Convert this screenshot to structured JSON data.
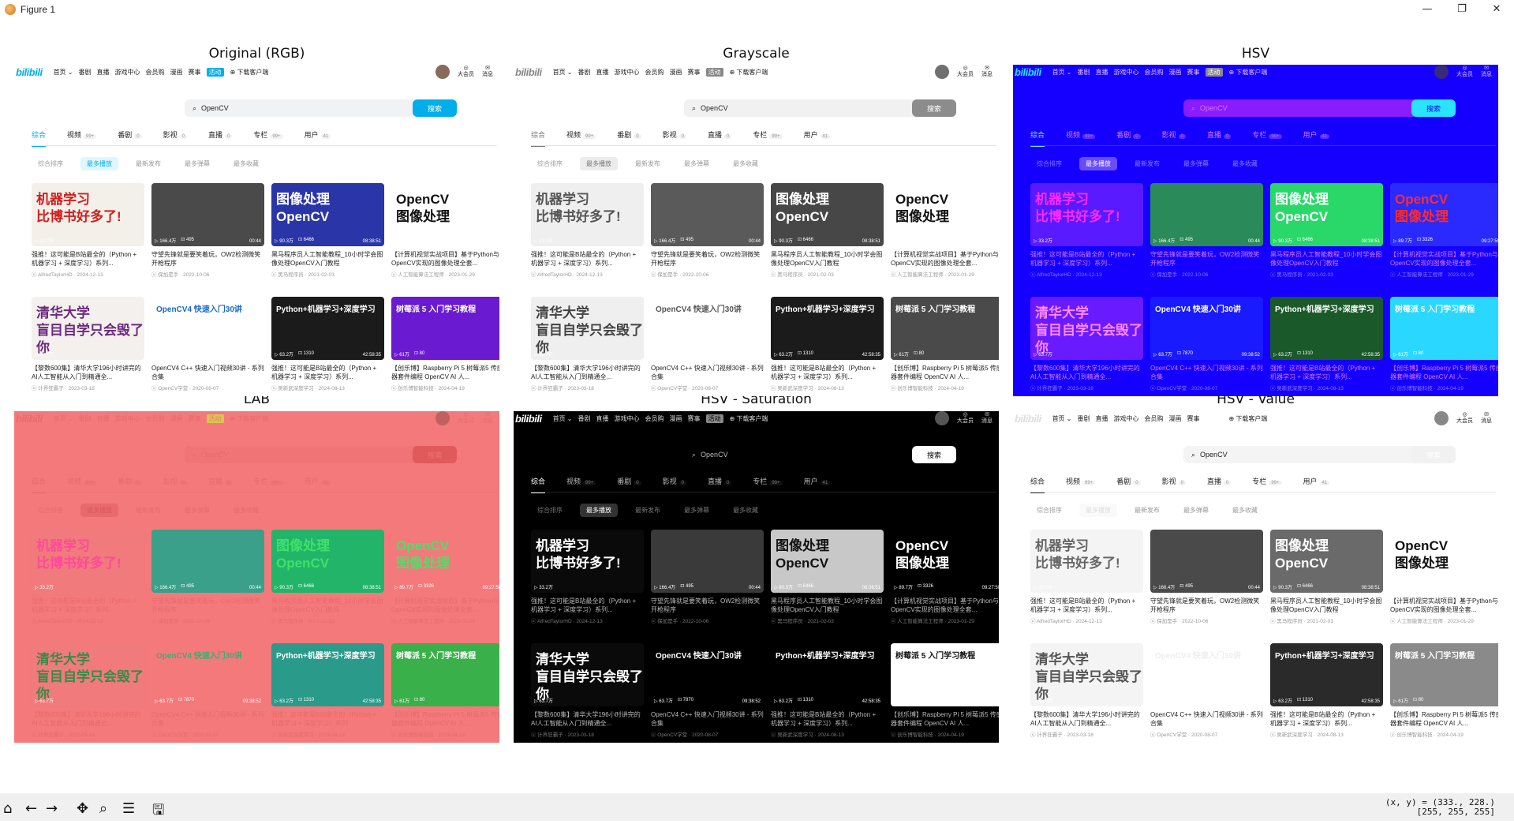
{
  "window": {
    "title": "Figure 1",
    "min": "—",
    "max": "❐",
    "close": "✕"
  },
  "panel_titles": [
    "Original (RGB)",
    "Grayscale",
    "HSV",
    "LAB",
    "HSV - Saturation",
    "HSV - Value"
  ],
  "site": {
    "logo": "bilibili",
    "nav_items": [
      "首页 ⌄",
      "番剧",
      "直播",
      "游戏中心",
      "会员购",
      "漫画",
      "赛事"
    ],
    "nav_badge": "活动",
    "download": "⊕ 下载客户端",
    "nav_right": [
      "大会员",
      "消息"
    ],
    "search_value": "OpenCV",
    "search_button": "搜索",
    "tabs": [
      {
        "label": "综合",
        "count": ""
      },
      {
        "label": "视频",
        "count": "99+"
      },
      {
        "label": "番剧",
        "count": "0"
      },
      {
        "label": "影视",
        "count": "0"
      },
      {
        "label": "直播",
        "count": "0"
      },
      {
        "label": "专栏",
        "count": "99+"
      },
      {
        "label": "用户",
        "count": "41"
      }
    ],
    "sorts": [
      "综合排序",
      "最多播放",
      "最新发布",
      "最多弹幕",
      "最多收藏"
    ],
    "cards": [
      {
        "thumb": "机器学习\n比博书好多了!",
        "plays": "▷ 33.2万",
        "likes": "",
        "duration": "",
        "title": "强推！这可能是B站最全的（Python + 机器学习 + 深度学习）系列...",
        "by": "ⓤ AlfredTaylorHD · 2024-12-13"
      },
      {
        "thumb": "",
        "plays": "▷ 166.4万",
        "likes": "⊡ 495",
        "duration": "00:44",
        "title": "守望先锋就是要笑着玩，OW2检测微笑开枪程序",
        "by": "ⓤ 保加是手 · 2022-10-06"
      },
      {
        "thumb": "图像处理\nOpenCV",
        "plays": "▷ 90.3万",
        "likes": "⊡ 6466",
        "duration": "08:38:51",
        "title": "黑马程序员人工智能教程_10小时学会图像处理OpenCV入门教程",
        "by": "ⓤ 黑马程序员 · 2021-02-03"
      },
      {
        "thumb": "OpenCV\n图像处理",
        "plays": "▷ 89.7万",
        "likes": "⊡ 3326",
        "duration": "09:27:50",
        "title": "【计算机视觉实战项目】基于Python与OpenCV实现的图像处理全套...",
        "by": "ⓤ 人工智能算法工程师 · 2023-01-29"
      },
      {
        "thumb": "清华大学\n盲目自学只会毁了你",
        "plays": "▷ 63.7万",
        "likes": "",
        "duration": "",
        "title": "【黎数600集】清华大学196小时讲完的AI人工智能从入门到精通全...",
        "by": "ⓤ 计界狂霸子 · 2023-03-18"
      },
      {
        "thumb": "OpenCV4 快速入门30讲",
        "plays": "▷ 63.7万",
        "likes": "⊡ 7870",
        "duration": "09:38:52",
        "title": "OpenCV4 C++ 快速入门视频30讲 - 系列合集",
        "by": "ⓤ OpenCV学堂 · 2020-08-07"
      },
      {
        "thumb": "Python+机器学习+深度学习",
        "plays": "▷ 63.2万",
        "likes": "⊡ 1310",
        "duration": "42:58:35",
        "title": "强推！这可能是B站最全的（Python + 机器学习 + 深度学习）系列...",
        "by": "ⓤ 吴新武深度学习 · 2024-08-13"
      },
      {
        "thumb": "树莓派 5 入门学习教程",
        "plays": "▷ 61万",
        "likes": "⊡ 80",
        "duration": "",
        "title": "【创乐博】Raspberry Pi 5 树莓派5 传感器套件编程 OpenCV AI 人...",
        "by": "ⓤ 创乐博智能科技 · 2024-04-19"
      }
    ]
  },
  "toolbar": {
    "icons": [
      "home-icon",
      "back-arrow-icon",
      "forward-arrow-icon",
      "pan-icon",
      "zoom-icon",
      "configure-icon",
      "save-icon"
    ]
  },
  "coords": {
    "line1": "(x, y) = (333., 228.)",
    "line2": "[255, 255, 255]"
  }
}
